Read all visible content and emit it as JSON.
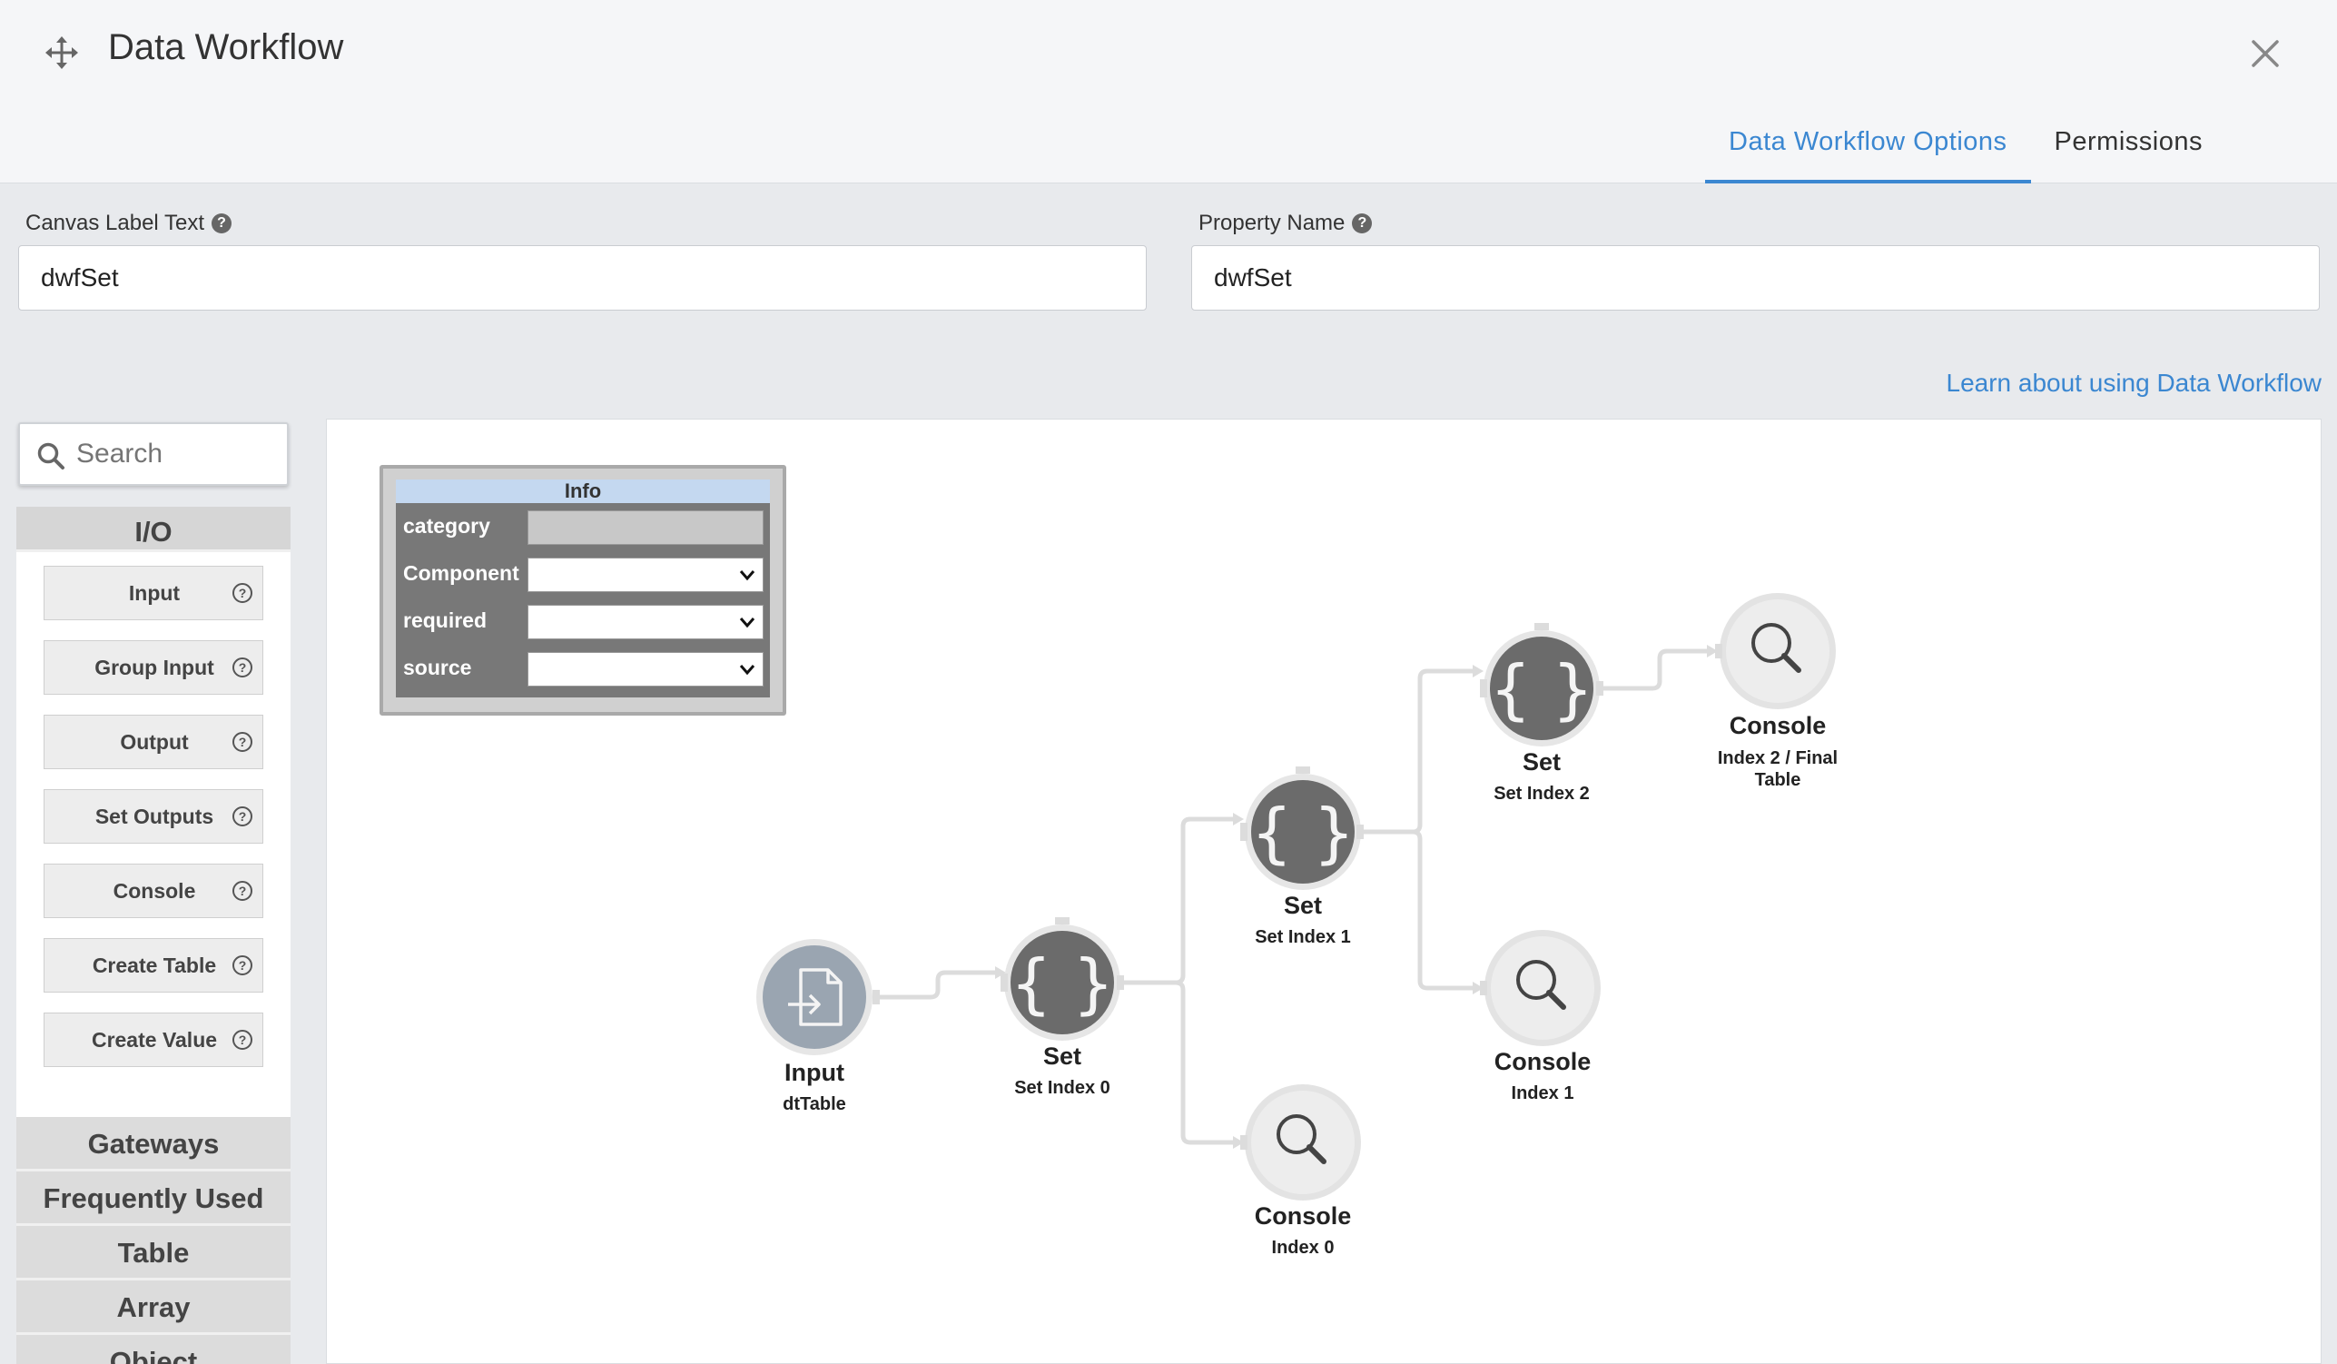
{
  "header": {
    "title": "Data Workflow",
    "tabs": [
      {
        "label": "Data Workflow Options",
        "active": true
      },
      {
        "label": "Permissions",
        "active": false
      }
    ]
  },
  "form": {
    "canvas_label": {
      "label": "Canvas Label Text",
      "value": "dwfSet"
    },
    "property_name": {
      "label": "Property Name",
      "value": "dwfSet"
    },
    "learn_link": "Learn about using Data Workflow"
  },
  "sidebar": {
    "search_placeholder": "Search",
    "groups": [
      {
        "title": "I/O",
        "items": [
          "Input",
          "Group Input",
          "Output",
          "Set Outputs",
          "Console",
          "Create Table",
          "Create Value"
        ]
      },
      {
        "title": "Gateways"
      },
      {
        "title": "Frequently Used"
      },
      {
        "title": "Table"
      },
      {
        "title": "Array"
      },
      {
        "title": "Object"
      }
    ]
  },
  "info_panel": {
    "title": "Info",
    "rows": [
      "category",
      "Component",
      "required",
      "source"
    ]
  },
  "nodes": [
    {
      "id": "input",
      "type": "Input",
      "label": "dtTable",
      "icon": "file-input-icon"
    },
    {
      "id": "set0",
      "type": "Set",
      "label": "Set Index 0",
      "icon": "braces-icon"
    },
    {
      "id": "set1",
      "type": "Set",
      "label": "Set Index 1",
      "icon": "braces-icon"
    },
    {
      "id": "set2",
      "type": "Set",
      "label": "Set Index 2",
      "icon": "braces-icon"
    },
    {
      "id": "console0",
      "type": "Console",
      "label": "Index 0",
      "icon": "magnifier-icon"
    },
    {
      "id": "console1",
      "type": "Console",
      "label": "Index 1",
      "icon": "magnifier-icon"
    },
    {
      "id": "console2",
      "type": "Console",
      "label": "Index 2 / Final Table",
      "icon": "magnifier-icon"
    }
  ],
  "colors": {
    "accent": "#3b87d1",
    "set_node": "#6b6b6b",
    "input_node": "#9aa5b1",
    "console_node": "#ececec"
  }
}
